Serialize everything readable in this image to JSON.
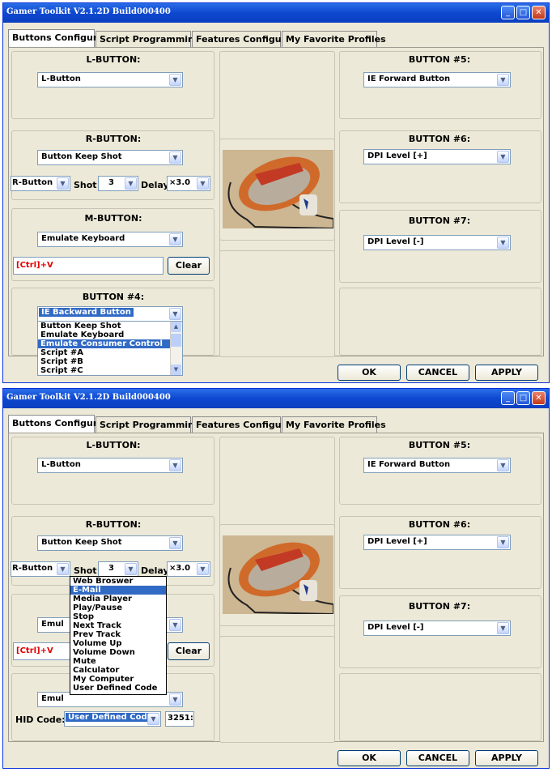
{
  "app": {
    "title": "Gamer Toolkit V2.1.2D Build000400",
    "tabs": [
      "Buttons Configure",
      "Script Programming",
      "Features Configure",
      "My Favorite Profiles"
    ],
    "window_controls": [
      "minimize-icon",
      "maximize-icon",
      "close-icon"
    ]
  },
  "s1": {
    "lbutton": {
      "title": "L-BUTTON:",
      "value": "L-Button"
    },
    "rbutton": {
      "title": "R-BUTTON:",
      "value": "Button Keep Shot",
      "btn": "R-Button",
      "shot_label": "Shot",
      "shot": "3",
      "delay_label": "Delay",
      "delay": "×3.0"
    },
    "mbutton": {
      "title": "M-BUTTON:",
      "value": "Emulate Keyboard",
      "keys": "[Ctrl]+V",
      "clear": "Clear"
    },
    "b4": {
      "title": "BUTTON #4:",
      "value": "IE Backward Button",
      "options": [
        "Button Keep Shot",
        "Emulate Keyboard",
        "Emulate Consumer Control",
        "Script #A",
        "Script #B",
        "Script #C"
      ],
      "highlighted": "Emulate Consumer Control"
    },
    "b5": {
      "title": "BUTTON #5:",
      "value": "IE Forward Button"
    },
    "b6": {
      "title": "BUTTON #6:",
      "value": "DPI Level [+]"
    },
    "b7": {
      "title": "BUTTON #7:",
      "value": "DPI Level [-]"
    },
    "ok": "OK",
    "cancel": "CANCEL",
    "apply": "APPLY"
  },
  "s2": {
    "lbutton": {
      "title": "L-BUTTON:",
      "value": "L-Button"
    },
    "rbutton": {
      "title": "R-BUTTON:",
      "value": "Button Keep Shot",
      "btn": "R-Button",
      "shot_label": "Shot",
      "shot": "3",
      "delay_label": "Delay",
      "delay": "×3.0"
    },
    "mbutton": {
      "value_visible": "Emul",
      "keys": "[Ctrl]+V",
      "clear": "Clear"
    },
    "b4": {
      "value_visible": "Emul",
      "hid_label": "HID Code:",
      "hid_value": "User Defined Code",
      "hid_number": "3251:"
    },
    "menu": [
      "Web Broswer",
      "E-Mail",
      "Media Player",
      "Play/Pause",
      "Stop",
      "Next Track",
      "Prev Track",
      "Volume Up",
      "Volume Down",
      "Mute",
      "Calculator",
      "My Computer",
      "User Defined Code"
    ],
    "menu_highlighted": "E-Mail",
    "b5": {
      "title": "BUTTON #5:",
      "value": "IE Forward Button"
    },
    "b6": {
      "title": "BUTTON #6:",
      "value": "DPI Level [+]"
    },
    "b7": {
      "title": "BUTTON #7:",
      "value": "DPI Level [-]"
    },
    "ok": "OK",
    "cancel": "CANCEL",
    "apply": "APPLY"
  },
  "colors": {
    "titlebar": "#0d48d0",
    "selection": "#316ac5",
    "keys_text": "#e00000",
    "window_bg": "#ece9d8"
  }
}
